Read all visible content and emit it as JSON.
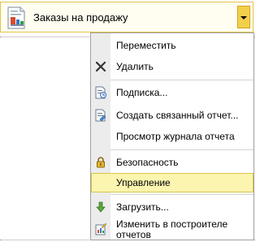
{
  "header": {
    "title": "Заказы на продажу",
    "icon": "report-icon",
    "dropdown_icon": "chevron-down-icon"
  },
  "menu": {
    "items": [
      {
        "label": "Переместить",
        "icon": ""
      },
      {
        "label": "Удалить",
        "icon": "delete-x-icon"
      },
      {
        "label": "Подписка...",
        "icon": "subscription-icon"
      },
      {
        "label": "Создать связанный отчет...",
        "icon": "linked-report-icon"
      },
      {
        "label": "Просмотр журнала отчета",
        "icon": ""
      },
      {
        "label": "Безопасность",
        "icon": "lock-icon"
      },
      {
        "label": "Управление",
        "icon": ""
      },
      {
        "label": "Загрузить...",
        "icon": "download-arrow-icon"
      },
      {
        "label": "Изменить в построителе отчетов",
        "icon": "report-builder-icon"
      }
    ],
    "highlighted_item": "Управление"
  },
  "colors": {
    "header_border": "#e3c44b",
    "dropdown_button": "#f4cf4c",
    "highlight_background": "#fbf5b0",
    "gutter": "#ececec"
  }
}
